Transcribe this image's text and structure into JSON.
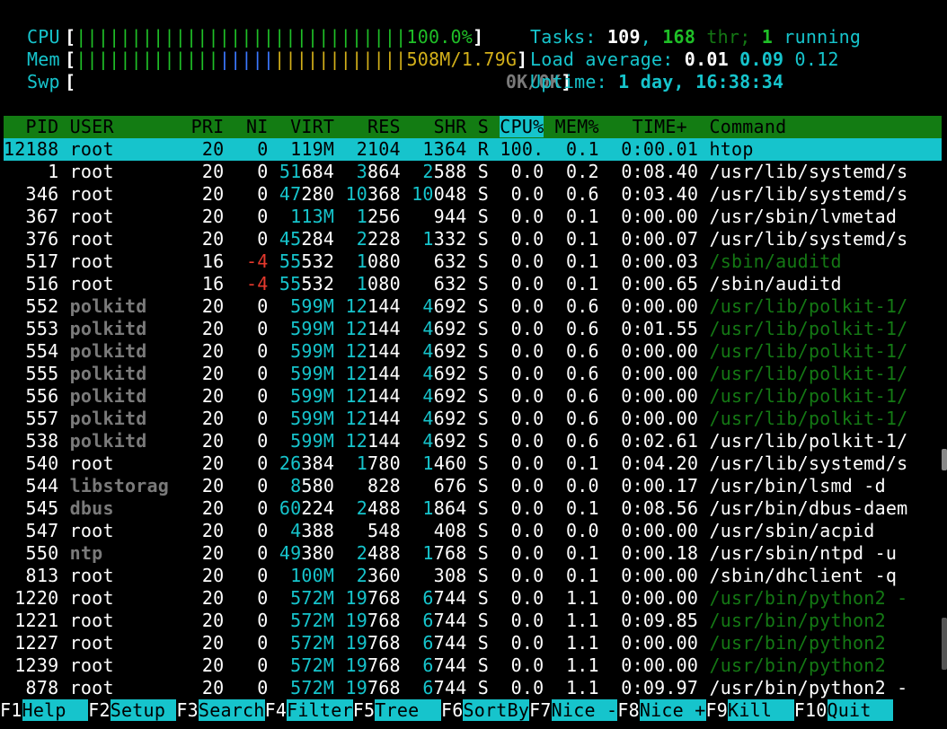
{
  "meters": {
    "cpu": {
      "label": "CPU",
      "bar": "||||||||||||||||||||||||||||||",
      "value": "100.0%",
      "fraction": 1.0
    },
    "mem": {
      "label": "Mem",
      "bar_green": "|||||||||||||",
      "bar_blue": "|||||",
      "bar_yellow": "||||||||||||",
      "value": "508M/1.79G"
    },
    "swp": {
      "label": "Swp",
      "value": "0K/0K"
    }
  },
  "summary": {
    "tasks_label": "Tasks: ",
    "tasks": "109",
    "sep1": ", ",
    "threads": "168",
    "thr_label": " thr; ",
    "running": "1",
    "running_label": " running",
    "load_label": "Load average: ",
    "load1": "0.01",
    "load5": "0.09",
    "load15": "0.12",
    "uptime_label": "Uptime: ",
    "uptime": "1 day, 16:38:34"
  },
  "columns": {
    "pid": "  PID",
    "user": "USER     ",
    "pri": "  PRI",
    "ni": "  NI",
    "virt": "  VIRT",
    "res": "   RES",
    "shr": "   SHR",
    "s": " S",
    "cpu": "CPU%",
    "mem": " MEM%",
    "time": "   TIME+ ",
    "cmd": " Command"
  },
  "processes": [
    {
      "pid": "12188",
      "user": "root",
      "user_style": "normal",
      "pri": "20",
      "ni": "0",
      "virt": "119M",
      "res": "2104",
      "shr": "1364",
      "s": "R",
      "cpu": "100.",
      "mem": "0.1",
      "time": "0:00.01",
      "cmd": "htop",
      "cmd_style": "normal",
      "selected": true
    },
    {
      "pid": "1",
      "user": "root",
      "user_style": "normal",
      "pri": "20",
      "ni": "0",
      "virt": "51684",
      "res": "3864",
      "shr": "2588",
      "s": "S",
      "cpu": "0.0",
      "mem": "0.2",
      "time": "0:08.40",
      "cmd": "/usr/lib/systemd/s",
      "cmd_style": "normal"
    },
    {
      "pid": "346",
      "user": "root",
      "user_style": "normal",
      "pri": "20",
      "ni": "0",
      "virt": "47280",
      "res": "10368",
      "shr": "10048",
      "s": "S",
      "cpu": "0.0",
      "mem": "0.6",
      "time": "0:03.40",
      "cmd": "/usr/lib/systemd/s",
      "cmd_style": "normal"
    },
    {
      "pid": "367",
      "user": "root",
      "user_style": "normal",
      "pri": "20",
      "ni": "0",
      "virt": "113M",
      "res": "1256",
      "shr": "944",
      "s": "S",
      "cpu": "0.0",
      "mem": "0.1",
      "time": "0:00.00",
      "cmd": "/usr/sbin/lvmetad",
      "cmd_style": "normal"
    },
    {
      "pid": "376",
      "user": "root",
      "user_style": "normal",
      "pri": "20",
      "ni": "0",
      "virt": "45284",
      "res": "2228",
      "shr": "1332",
      "s": "S",
      "cpu": "0.0",
      "mem": "0.1",
      "time": "0:00.07",
      "cmd": "/usr/lib/systemd/s",
      "cmd_style": "normal"
    },
    {
      "pid": "517",
      "user": "root",
      "user_style": "normal",
      "pri": "16",
      "ni": "-4",
      "virt": "55532",
      "res": "1080",
      "shr": "632",
      "s": "S",
      "cpu": "0.0",
      "mem": "0.1",
      "time": "0:00.03",
      "cmd": "/sbin/auditd",
      "cmd_style": "thread"
    },
    {
      "pid": "516",
      "user": "root",
      "user_style": "normal",
      "pri": "16",
      "ni": "-4",
      "virt": "55532",
      "res": "1080",
      "shr": "632",
      "s": "S",
      "cpu": "0.0",
      "mem": "0.1",
      "time": "0:00.65",
      "cmd": "/sbin/auditd",
      "cmd_style": "normal"
    },
    {
      "pid": "552",
      "user": "polkitd",
      "user_style": "dim",
      "pri": "20",
      "ni": "0",
      "virt": "599M",
      "res": "12144",
      "shr": "4692",
      "s": "S",
      "cpu": "0.0",
      "mem": "0.6",
      "time": "0:00.00",
      "cmd": "/usr/lib/polkit-1/",
      "cmd_style": "thread"
    },
    {
      "pid": "553",
      "user": "polkitd",
      "user_style": "dim",
      "pri": "20",
      "ni": "0",
      "virt": "599M",
      "res": "12144",
      "shr": "4692",
      "s": "S",
      "cpu": "0.0",
      "mem": "0.6",
      "time": "0:01.55",
      "cmd": "/usr/lib/polkit-1/",
      "cmd_style": "thread"
    },
    {
      "pid": "554",
      "user": "polkitd",
      "user_style": "dim",
      "pri": "20",
      "ni": "0",
      "virt": "599M",
      "res": "12144",
      "shr": "4692",
      "s": "S",
      "cpu": "0.0",
      "mem": "0.6",
      "time": "0:00.00",
      "cmd": "/usr/lib/polkit-1/",
      "cmd_style": "thread"
    },
    {
      "pid": "555",
      "user": "polkitd",
      "user_style": "dim",
      "pri": "20",
      "ni": "0",
      "virt": "599M",
      "res": "12144",
      "shr": "4692",
      "s": "S",
      "cpu": "0.0",
      "mem": "0.6",
      "time": "0:00.00",
      "cmd": "/usr/lib/polkit-1/",
      "cmd_style": "thread"
    },
    {
      "pid": "556",
      "user": "polkitd",
      "user_style": "dim",
      "pri": "20",
      "ni": "0",
      "virt": "599M",
      "res": "12144",
      "shr": "4692",
      "s": "S",
      "cpu": "0.0",
      "mem": "0.6",
      "time": "0:00.00",
      "cmd": "/usr/lib/polkit-1/",
      "cmd_style": "thread"
    },
    {
      "pid": "557",
      "user": "polkitd",
      "user_style": "dim",
      "pri": "20",
      "ni": "0",
      "virt": "599M",
      "res": "12144",
      "shr": "4692",
      "s": "S",
      "cpu": "0.0",
      "mem": "0.6",
      "time": "0:00.00",
      "cmd": "/usr/lib/polkit-1/",
      "cmd_style": "thread"
    },
    {
      "pid": "538",
      "user": "polkitd",
      "user_style": "dim",
      "pri": "20",
      "ni": "0",
      "virt": "599M",
      "res": "12144",
      "shr": "4692",
      "s": "S",
      "cpu": "0.0",
      "mem": "0.6",
      "time": "0:02.61",
      "cmd": "/usr/lib/polkit-1/",
      "cmd_style": "normal"
    },
    {
      "pid": "540",
      "user": "root",
      "user_style": "normal",
      "pri": "20",
      "ni": "0",
      "virt": "26384",
      "res": "1780",
      "shr": "1460",
      "s": "S",
      "cpu": "0.0",
      "mem": "0.1",
      "time": "0:04.20",
      "cmd": "/usr/lib/systemd/s",
      "cmd_style": "normal"
    },
    {
      "pid": "544",
      "user": "libstorag",
      "user_style": "dim",
      "pri": "20",
      "ni": "0",
      "virt": "8580",
      "res": "828",
      "shr": "676",
      "s": "S",
      "cpu": "0.0",
      "mem": "0.0",
      "time": "0:00.17",
      "cmd": "/usr/bin/lsmd -d",
      "cmd_style": "normal"
    },
    {
      "pid": "545",
      "user": "dbus",
      "user_style": "dim",
      "pri": "20",
      "ni": "0",
      "virt": "60224",
      "res": "2488",
      "shr": "1864",
      "s": "S",
      "cpu": "0.0",
      "mem": "0.1",
      "time": "0:08.56",
      "cmd": "/usr/bin/dbus-daem",
      "cmd_style": "normal"
    },
    {
      "pid": "547",
      "user": "root",
      "user_style": "normal",
      "pri": "20",
      "ni": "0",
      "virt": "4388",
      "res": "548",
      "shr": "408",
      "s": "S",
      "cpu": "0.0",
      "mem": "0.0",
      "time": "0:00.00",
      "cmd": "/usr/sbin/acpid",
      "cmd_style": "normal"
    },
    {
      "pid": "550",
      "user": "ntp",
      "user_style": "dim",
      "pri": "20",
      "ni": "0",
      "virt": "49380",
      "res": "2488",
      "shr": "1768",
      "s": "S",
      "cpu": "0.0",
      "mem": "0.1",
      "time": "0:00.18",
      "cmd": "/usr/sbin/ntpd -u",
      "cmd_style": "normal"
    },
    {
      "pid": "813",
      "user": "root",
      "user_style": "normal",
      "pri": "20",
      "ni": "0",
      "virt": "100M",
      "res": "2360",
      "shr": "308",
      "s": "S",
      "cpu": "0.0",
      "mem": "0.1",
      "time": "0:00.00",
      "cmd": "/sbin/dhclient -q",
      "cmd_style": "normal"
    },
    {
      "pid": "1220",
      "user": "root",
      "user_style": "normal",
      "pri": "20",
      "ni": "0",
      "virt": "572M",
      "res": "19768",
      "shr": "6744",
      "s": "S",
      "cpu": "0.0",
      "mem": "1.1",
      "time": "0:00.00",
      "cmd": "/usr/bin/python2 -",
      "cmd_style": "thread"
    },
    {
      "pid": "1221",
      "user": "root",
      "user_style": "normal",
      "pri": "20",
      "ni": "0",
      "virt": "572M",
      "res": "19768",
      "shr": "6744",
      "s": "S",
      "cpu": "0.0",
      "mem": "1.1",
      "time": "0:09.85",
      "cmd": "/usr/bin/python2",
      "cmd_style": "thread"
    },
    {
      "pid": "1227",
      "user": "root",
      "user_style": "normal",
      "pri": "20",
      "ni": "0",
      "virt": "572M",
      "res": "19768",
      "shr": "6744",
      "s": "S",
      "cpu": "0.0",
      "mem": "1.1",
      "time": "0:00.00",
      "cmd": "/usr/bin/python2",
      "cmd_style": "thread"
    },
    {
      "pid": "1239",
      "user": "root",
      "user_style": "normal",
      "pri": "20",
      "ni": "0",
      "virt": "572M",
      "res": "19768",
      "shr": "6744",
      "s": "S",
      "cpu": "0.0",
      "mem": "1.1",
      "time": "0:00.00",
      "cmd": "/usr/bin/python2",
      "cmd_style": "thread"
    },
    {
      "pid": "878",
      "user": "root",
      "user_style": "normal",
      "pri": "20",
      "ni": "0",
      "virt": "572M",
      "res": "19768",
      "shr": "6744",
      "s": "S",
      "cpu": "0.0",
      "mem": "1.1",
      "time": "0:09.97",
      "cmd": "/usr/bin/python2 -",
      "cmd_style": "normal"
    }
  ],
  "footer": [
    {
      "key": "F1",
      "label": "Help  "
    },
    {
      "key": "F2",
      "label": "Setup "
    },
    {
      "key": "F3",
      "label": "Search"
    },
    {
      "key": "F4",
      "label": "Filter"
    },
    {
      "key": "F5",
      "label": "Tree  "
    },
    {
      "key": "F6",
      "label": "SortBy"
    },
    {
      "key": "F7",
      "label": "Nice -"
    },
    {
      "key": "F8",
      "label": "Nice +"
    },
    {
      "key": "F9",
      "label": "Kill  "
    },
    {
      "key": "F10",
      "label": "Quit  "
    }
  ],
  "colors": {
    "cyan": "#16c4cc",
    "green": "#1fbf27",
    "header_bg": "#137c13",
    "thread_cmd": "#147814",
    "negative_nice": "#e5392d",
    "dim_user": "#7a7a7a"
  }
}
